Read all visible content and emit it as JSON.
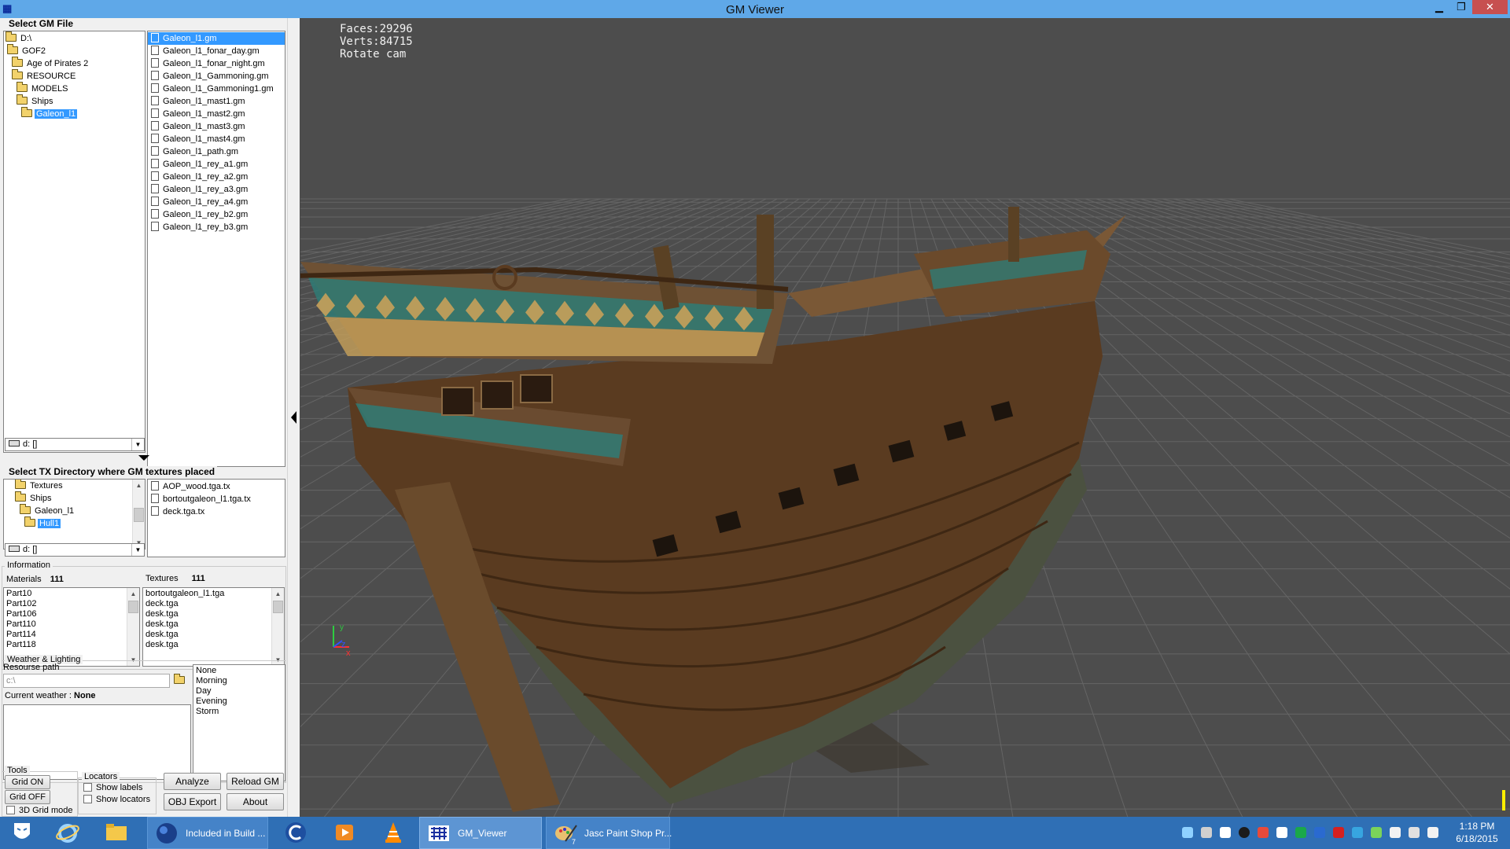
{
  "window": {
    "title": "GM Viewer",
    "icon": "app-icon",
    "controls": [
      "minimize-icon",
      "restore-icon",
      "close-icon"
    ]
  },
  "gm_file": {
    "label": "Select GM File",
    "tree": [
      {
        "label": "D:\\",
        "selected": false
      },
      {
        "label": "GOF2",
        "selected": false
      },
      {
        "label": "Age of Pirates 2",
        "selected": false
      },
      {
        "label": "RESOURCE",
        "selected": false
      },
      {
        "label": "MODELS",
        "selected": false
      },
      {
        "label": "Ships",
        "selected": false
      },
      {
        "label": "Galeon_l1",
        "selected": true
      }
    ],
    "drive": "d: []",
    "files": [
      "Galeon_l1.gm",
      "Galeon_l1_fonar_day.gm",
      "Galeon_l1_fonar_night.gm",
      "Galeon_l1_Gammoning.gm",
      "Galeon_l1_Gammoning1.gm",
      "Galeon_l1_mast1.gm",
      "Galeon_l1_mast2.gm",
      "Galeon_l1_mast3.gm",
      "Galeon_l1_mast4.gm",
      "Galeon_l1_path.gm",
      "Galeon_l1_rey_a1.gm",
      "Galeon_l1_rey_a2.gm",
      "Galeon_l1_rey_a3.gm",
      "Galeon_l1_rey_a4.gm",
      "Galeon_l1_rey_b2.gm",
      "Galeon_l1_rey_b3.gm"
    ],
    "selected_file": "Galeon_l1.gm"
  },
  "tx_dir": {
    "label": "Select TX Directory where GM textures placed",
    "tree": [
      {
        "label": "Textures",
        "selected": false
      },
      {
        "label": "Ships",
        "selected": false
      },
      {
        "label": "Galeon_l1",
        "selected": false
      },
      {
        "label": "Hull1",
        "selected": true
      }
    ],
    "drive": "d: []",
    "files": [
      "AOP_wood.tga.tx",
      "bortoutgaleon_l1.tga.tx",
      "deck.tga.tx"
    ]
  },
  "information": {
    "label": "Information",
    "materials_label": "Materials",
    "materials_count": "111",
    "textures_label": "Textures",
    "textures_count": "111",
    "materials": [
      "Part10",
      "Part102",
      "Part106",
      "Part110",
      "Part114",
      "Part118"
    ],
    "textures": [
      "bortoutgaleon_l1.tga",
      "deck.tga",
      "desk.tga",
      "desk.tga",
      "desk.tga",
      "desk.tga"
    ]
  },
  "weather": {
    "label": "Weather & Lighting",
    "resource_path_label": "Resourse path",
    "resource_path_value": "c:\\",
    "current_weather_label": "Current weather :",
    "current_weather_value": "None",
    "options": [
      "None",
      "Morning",
      "Day",
      "Evening",
      "Storm"
    ]
  },
  "tools": {
    "label": "Tools",
    "grid_on": "Grid ON",
    "grid_off": "Grid OFF",
    "grid_3d": "3D Grid mode",
    "locators_label": "Locators",
    "show_labels": "Show labels",
    "show_locators": "Show locators",
    "analyze": "Analyze",
    "reload": "Reload GM",
    "obj_export": "OBJ Export",
    "about": "About"
  },
  "viewport": {
    "faces": "Faces:29296",
    "verts": "Verts:84715",
    "mode": "Rotate cam",
    "axis_labels": [
      "y",
      "z",
      "x"
    ],
    "colors": {
      "background": "#4d4d4d",
      "grid": "#6a6a6a"
    }
  },
  "taskbar": {
    "items": [
      {
        "icon": "start-mask-icon",
        "label": ""
      },
      {
        "icon": "internet-explorer-icon",
        "label": ""
      },
      {
        "icon": "file-explorer-icon",
        "label": ""
      },
      {
        "icon": "browser-globe-icon",
        "label": "Included in Build ..."
      },
      {
        "icon": "ccleaner-icon",
        "label": ""
      },
      {
        "icon": "media-player-icon",
        "label": ""
      },
      {
        "icon": "vlc-icon",
        "label": ""
      },
      {
        "icon": "gm-viewer-icon",
        "label": "GM_Viewer"
      },
      {
        "icon": "paint-shop-pro-icon",
        "label": "Jasc Paint Shop Pr..."
      }
    ],
    "badge": "7",
    "time": "1:18 PM",
    "date": "6/18/2015"
  }
}
